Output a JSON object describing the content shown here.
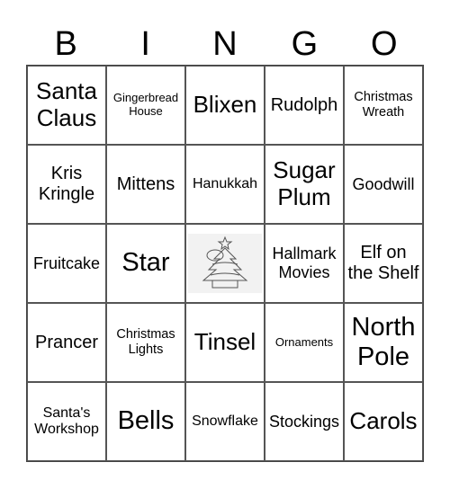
{
  "header": [
    "B",
    "I",
    "N",
    "G",
    "O"
  ],
  "cells": [
    {
      "text": "Santa Claus",
      "size": "l"
    },
    {
      "text": "Gingerbread House",
      "size": "xxs"
    },
    {
      "text": "Blixen",
      "size": "l"
    },
    {
      "text": "Rudolph",
      "size": "m"
    },
    {
      "text": "Christmas Wreath",
      "size": "xs"
    },
    {
      "text": "Kris Kringle",
      "size": "m"
    },
    {
      "text": "Mittens",
      "size": "m"
    },
    {
      "text": "Hanukkah",
      "size": "s"
    },
    {
      "text": "Sugar Plum",
      "size": "l"
    },
    {
      "text": "Goodwill",
      "size": "sm"
    },
    {
      "text": "Fruitcake",
      "size": "sm"
    },
    {
      "text": "Star",
      "size": "xl"
    },
    {
      "text": "",
      "size": "free",
      "icon": "christmas-tree-image"
    },
    {
      "text": "Hallmark Movies",
      "size": "sm"
    },
    {
      "text": "Elf on the Shelf",
      "size": "m"
    },
    {
      "text": "Prancer",
      "size": "m"
    },
    {
      "text": "Christmas Lights",
      "size": "xs"
    },
    {
      "text": "Tinsel",
      "size": "l"
    },
    {
      "text": "Ornaments",
      "size": "xxs"
    },
    {
      "text": "North Pole",
      "size": "xl"
    },
    {
      "text": "Santa's Workshop",
      "size": "s"
    },
    {
      "text": "Bells",
      "size": "xl"
    },
    {
      "text": "Snowflake",
      "size": "s"
    },
    {
      "text": "Stockings",
      "size": "sm"
    },
    {
      "text": "Carols",
      "size": "l"
    }
  ]
}
